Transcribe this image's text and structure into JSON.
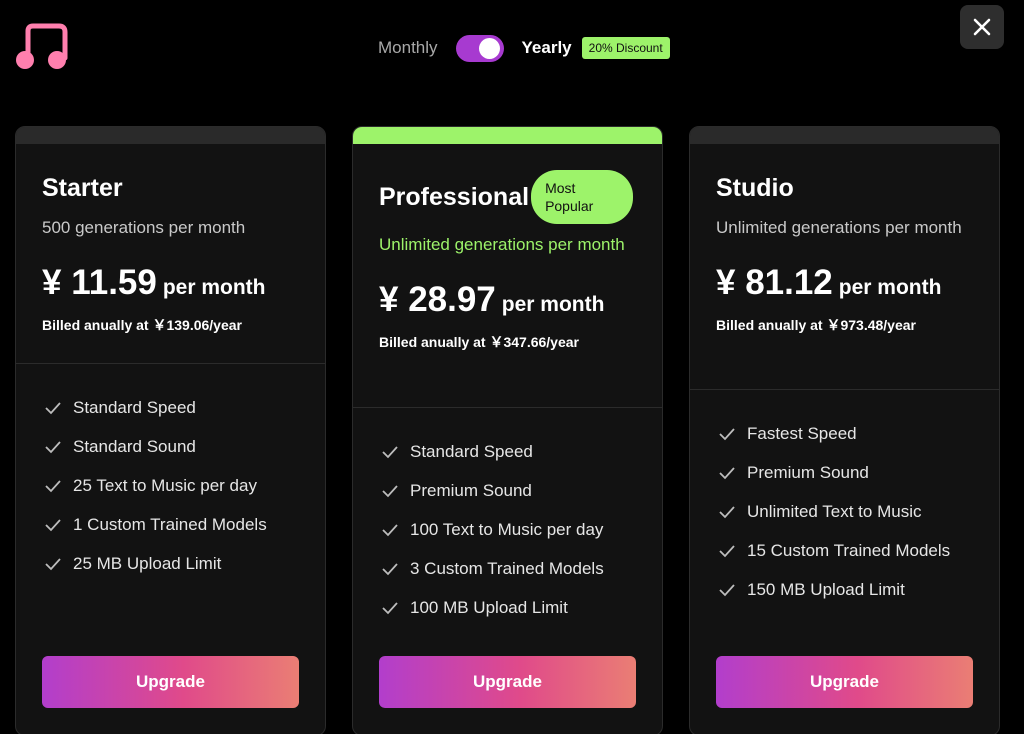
{
  "app": {
    "logo_icon": "music-note-icon",
    "close_icon": "close-icon",
    "brand_color": "#ff7fae"
  },
  "billing": {
    "monthly_label": "Monthly",
    "yearly_label": "Yearly",
    "discount_badge": "20% Discount",
    "toggle_state": "yearly",
    "accent_color": "#a73ad0",
    "badge_color": "#9df36a"
  },
  "plans": [
    {
      "name": "Starter",
      "description": "500 generations per month",
      "price": "¥ 11.59",
      "per": "per month",
      "billed": "Billed anually at ￥139.06/year",
      "features": [
        "Standard Speed",
        "Standard Sound",
        "25 Text to Music per day",
        "1 Custom Trained Models",
        "25 MB Upload Limit"
      ],
      "button": "Upgrade"
    },
    {
      "name": "Professional",
      "badge": "Most Popular",
      "description": "Unlimited generations per month",
      "price": "¥ 28.97",
      "per": "per month",
      "billed": "Billed anually at ￥347.66/year",
      "features": [
        "Standard Speed",
        "Premium Sound",
        "100 Text to Music per day",
        "3 Custom Trained Models",
        "100 MB Upload Limit"
      ],
      "button": "Upgrade"
    },
    {
      "name": "Studio",
      "description": "Unlimited generations per month",
      "price": "¥ 81.12",
      "per": "per month",
      "billed": "Billed anually at ￥973.48/year",
      "features": [
        "Fastest Speed",
        "Premium Sound",
        "Unlimited Text to Music",
        "15 Custom Trained Models",
        "150 MB Upload Limit"
      ],
      "button": "Upgrade"
    }
  ]
}
